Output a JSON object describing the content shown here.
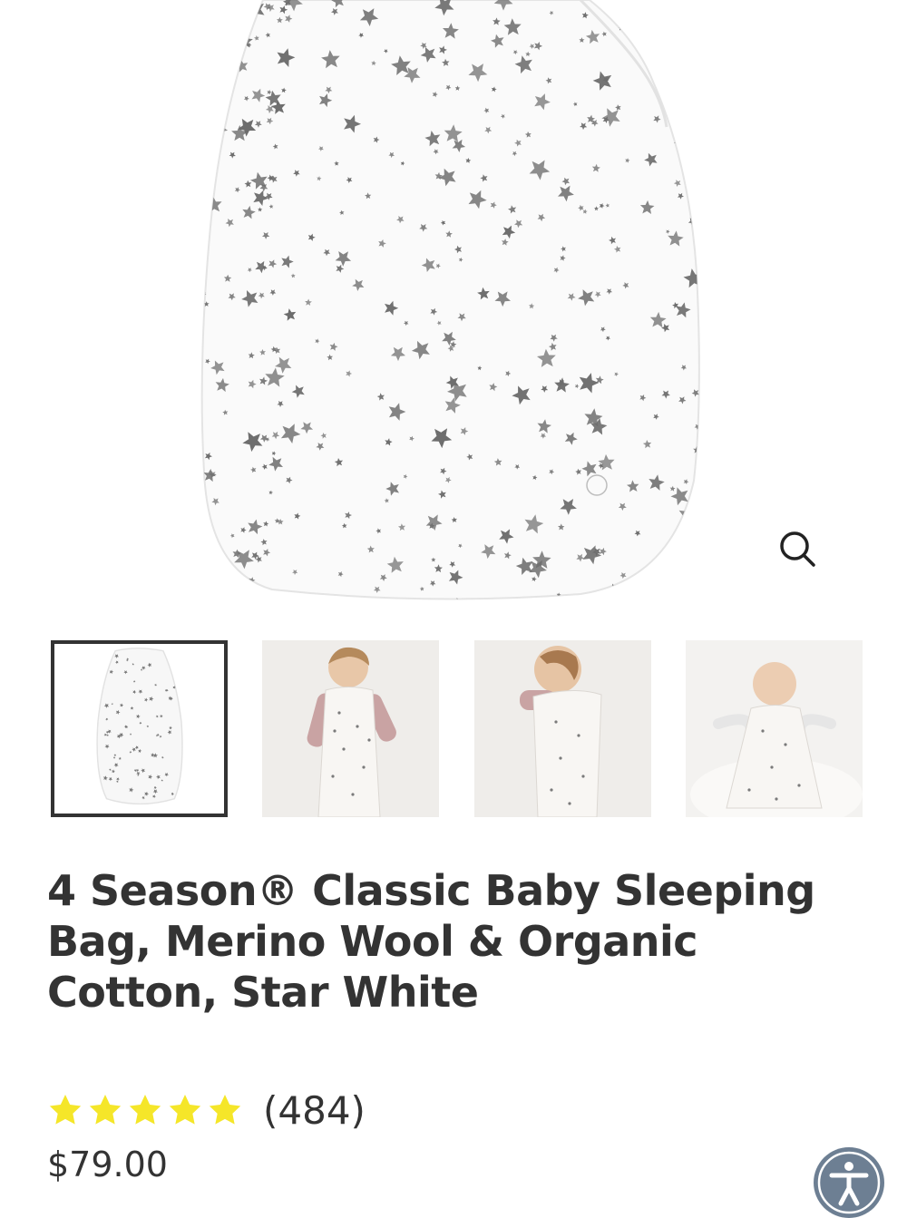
{
  "gallery": {
    "main_image_alt": "4 Season Classic Baby Sleeping Bag, Star White",
    "zoom_icon": "search-icon",
    "thumbnails": [
      {
        "alt": "Sleeping bag flat lay",
        "active": true
      },
      {
        "alt": "Toddler lying in sleeping bag",
        "active": false
      },
      {
        "alt": "Baby sleeping on side in sleeping bag",
        "active": false
      },
      {
        "alt": "Baby lying on sheepskin in sleeping bag",
        "active": false
      }
    ]
  },
  "product": {
    "title": "4 Season® Classic Baby Sleeping Bag, Merino Wool & Organic Cotton, Star White",
    "rating_value": 5,
    "rating_max": 5,
    "review_count": "(484)",
    "price": "$79.00"
  },
  "colors": {
    "text": "#333333",
    "star": "#f5e629",
    "accessibility_button": "#6d7f93"
  },
  "accessibility": {
    "icon": "accessibility-icon"
  }
}
